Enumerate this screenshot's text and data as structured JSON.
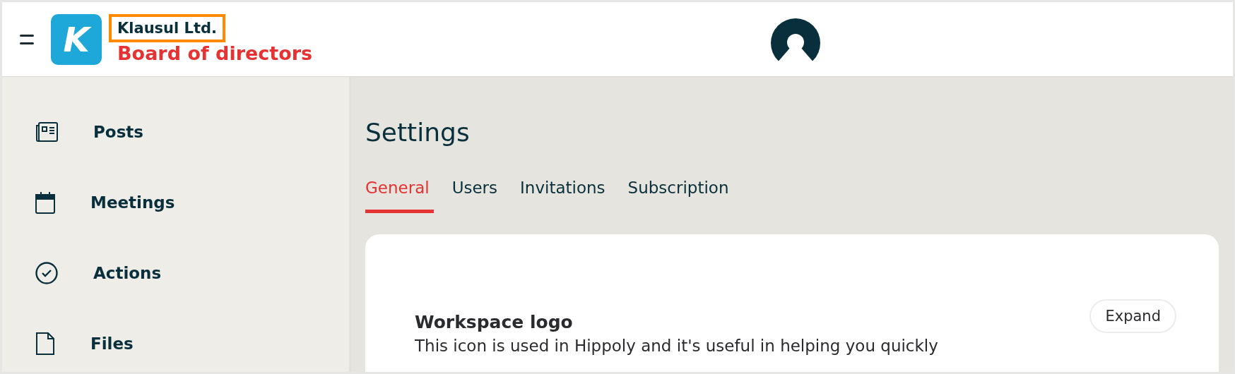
{
  "header": {
    "logo_letter": "K",
    "company": {
      "name": "Klausul Ltd.",
      "highlighted": true
    },
    "board": "Board of directors"
  },
  "sidebar": {
    "items": [
      {
        "label": "Posts",
        "kind": "posts"
      },
      {
        "label": "Meetings",
        "kind": "meetings"
      },
      {
        "label": "Actions",
        "kind": "actions"
      },
      {
        "label": "Files",
        "kind": "files"
      }
    ]
  },
  "page": {
    "title": "Settings",
    "tabs": [
      {
        "label": "General",
        "selected": true
      },
      {
        "label": "Users",
        "selected": false
      },
      {
        "label": "Invitations",
        "selected": false
      },
      {
        "label": "Subscription",
        "selected": false
      }
    ],
    "card": {
      "title": "Workspace logo",
      "description": "This icon is used in Hippoly and it's useful in helping you quickly",
      "button": "Expand"
    }
  }
}
